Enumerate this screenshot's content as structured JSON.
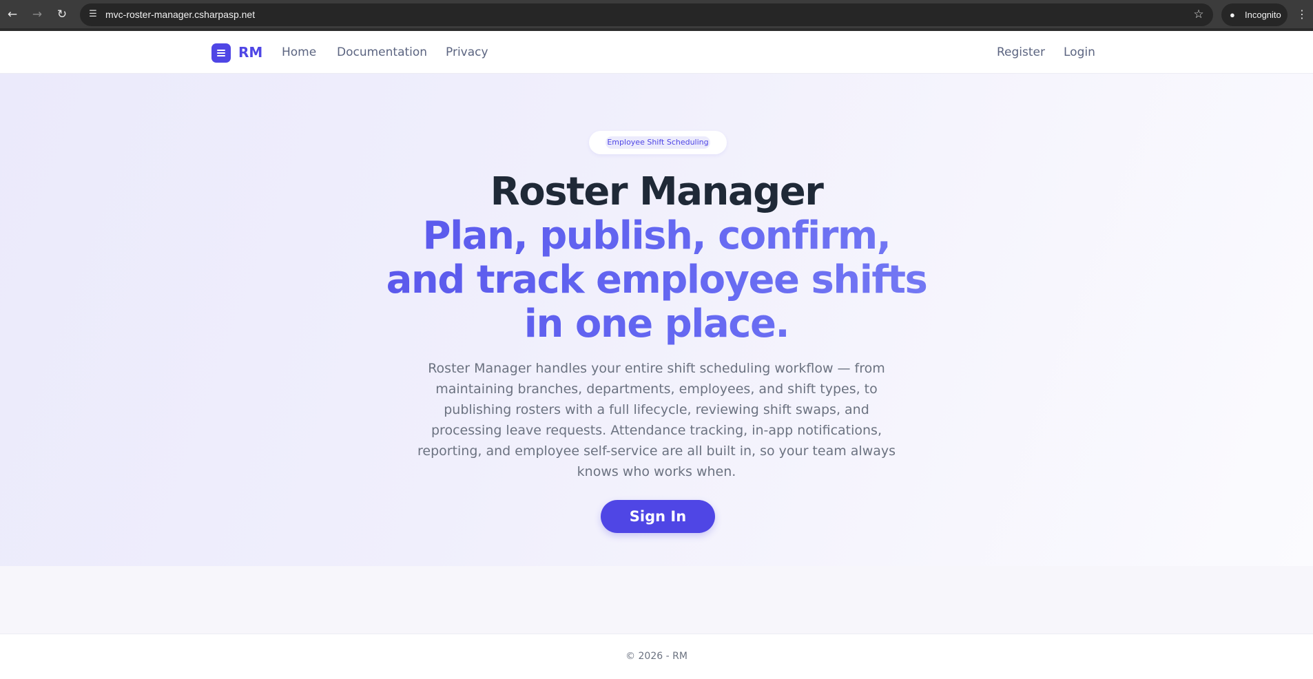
{
  "browser": {
    "url": "mvc-roster-manager.csharpasp.net",
    "profile_label": "Incognito",
    "icons": {
      "back": "back-arrow-icon",
      "forward": "forward-arrow-icon",
      "reload": "reload-icon",
      "site_info": "tune-icon",
      "bookmark": "star-icon",
      "incognito": "incognito-icon",
      "menu": "kebab-menu-icon"
    }
  },
  "navbar": {
    "brand": "RM",
    "brand_icon": "menu-lines-icon",
    "links": [
      "Home",
      "Documentation",
      "Privacy"
    ],
    "auth_links": [
      "Register",
      "Login"
    ]
  },
  "hero": {
    "badge": "Employee Shift Scheduling",
    "title": "Roster Manager",
    "tagline_lines": [
      "Plan, publish, confirm,",
      "and track employee shifts",
      "in one place."
    ],
    "description": "Roster Manager handles your entire shift scheduling workflow — from maintaining branches, departments, employees, and shift types, to publishing rosters with a full lifecycle, reviewing shift swaps, and processing leave requests. Attendance tracking, in-app notifications, reporting, and employee self-service are all built in, so your team always knows who works when.",
    "cta_label": "Sign In"
  },
  "footer": {
    "copyright": "© 2026 - RM"
  },
  "colors": {
    "brand": "#4f46e5",
    "heading": "#1f2937",
    "body_text": "#6b7280",
    "nav_text": "#5b6480",
    "chrome": "#3c3c3c"
  }
}
